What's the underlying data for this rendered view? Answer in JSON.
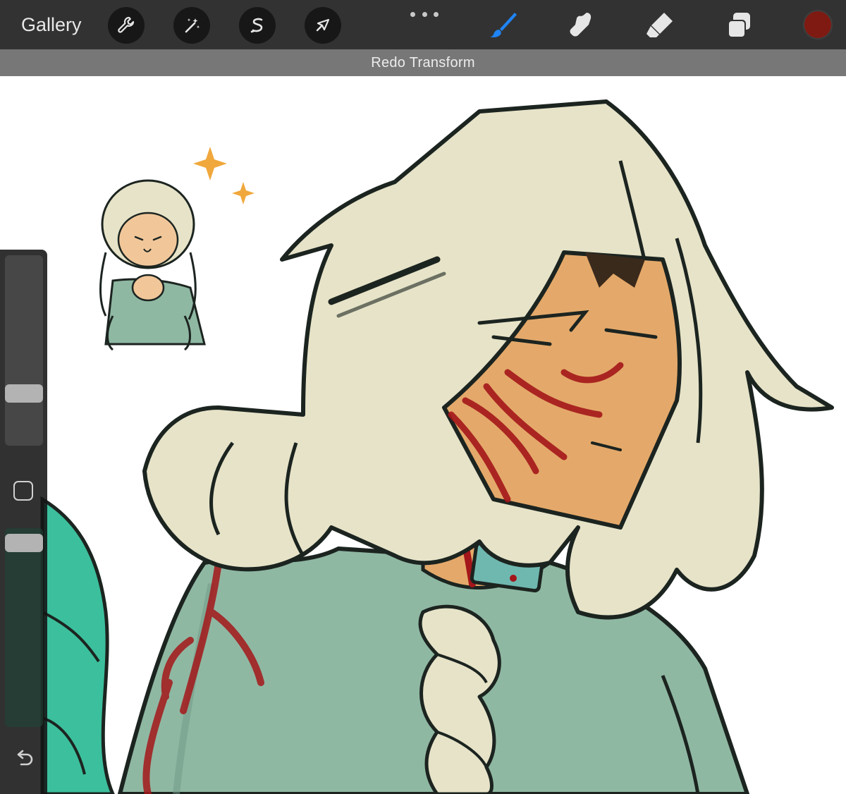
{
  "toolbar": {
    "gallery_label": "Gallery",
    "left_tools": [
      {
        "name": "actions",
        "icon": "wrench-icon"
      },
      {
        "name": "adjustments",
        "icon": "magic-wand-icon"
      },
      {
        "name": "selection",
        "icon": "selection-s-icon"
      },
      {
        "name": "transform",
        "icon": "arrow-cursor-icon"
      }
    ],
    "more_icon": "more-dots-icon",
    "right_tools": [
      {
        "name": "brush",
        "icon": "brush-icon",
        "active": true
      },
      {
        "name": "smudge",
        "icon": "smudge-finger-icon"
      },
      {
        "name": "eraser",
        "icon": "eraser-icon"
      },
      {
        "name": "layers",
        "icon": "layers-icon"
      }
    ],
    "current_color": "#7f1a12"
  },
  "status": {
    "message": "Redo Transform"
  },
  "sidebar": {
    "brush_size_level": 0.25,
    "opacity_level": 0.97,
    "modify_icon": "square-icon",
    "undo_icon": "undo-arrow-icon"
  },
  "colors": {
    "toolbar_bg": "#323232",
    "status_bg": "#777777",
    "accent_blue": "#1f84f5",
    "hair": "#e6e3c8",
    "skin": "#e4a96a",
    "shirt": "#8fb8a3",
    "blood": "#a3161a",
    "outline": "#1c2420"
  }
}
